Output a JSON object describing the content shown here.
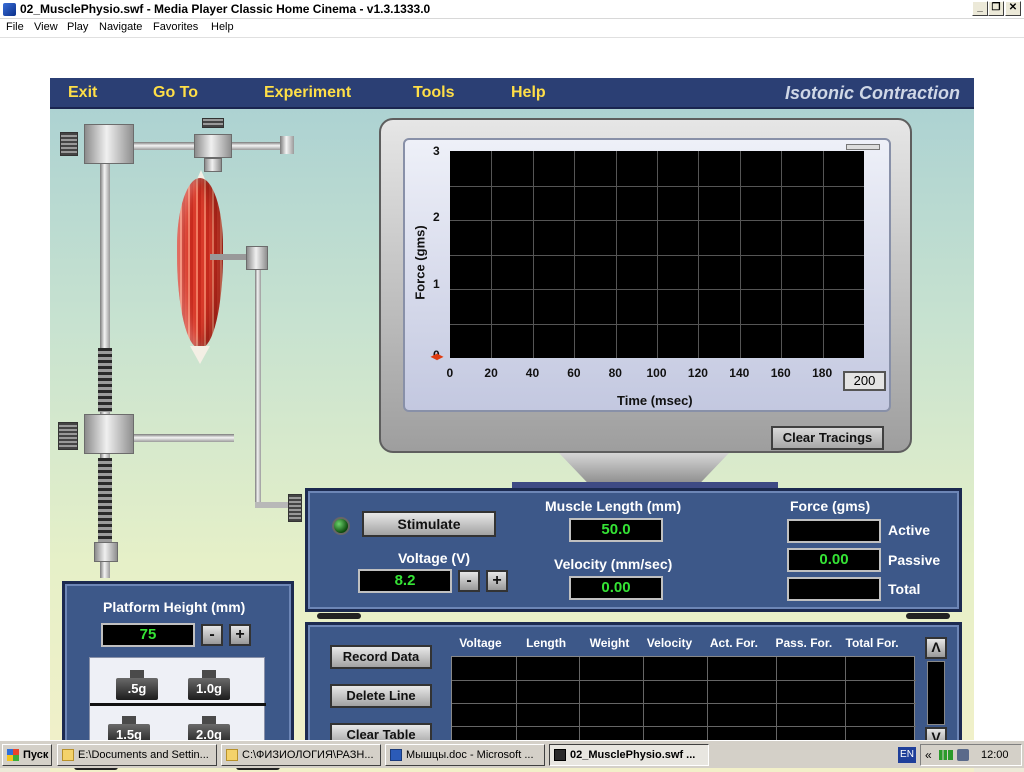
{
  "window": {
    "title": "02_MusclePhysio.swf - Media Player Classic Home Cinema - v1.3.1333.0",
    "buttons": {
      "minimize": "_",
      "restore": "❐",
      "close": "✕"
    }
  },
  "menubar": {
    "items": [
      "File",
      "View",
      "Play",
      "Navigate",
      "Favorites",
      "Help"
    ]
  },
  "nav": {
    "items": [
      "Exit",
      "Go To",
      "Experiment",
      "Tools",
      "Help"
    ],
    "experiment_title": "Isotonic Contraction"
  },
  "oscilloscope": {
    "ylabel": "Force (gms)",
    "xlabel": "Time (msec)",
    "y_ticks": [
      "3",
      "2",
      "1",
      "0"
    ],
    "x_ticks": [
      "0",
      "20",
      "40",
      "60",
      "80",
      "100",
      "120",
      "140",
      "160",
      "180"
    ],
    "x_max_button": "200",
    "clear_label": "Clear Tracings",
    "ylim": [
      0,
      3
    ],
    "xlim": [
      0,
      200
    ]
  },
  "stimulator": {
    "stimulate_label": "Stimulate",
    "voltage_label": "Voltage (V)",
    "voltage_value": "8.2",
    "minus": "-",
    "plus": "+",
    "muscle_length_label": "Muscle Length (mm)",
    "muscle_length_value": "50.0",
    "velocity_label": "Velocity (mm/sec)",
    "velocity_value": "0.00",
    "force_label": "Force (gms)",
    "active_label": "Active",
    "active_value": "",
    "passive_label": "Passive",
    "passive_value": "0.00",
    "total_label": "Total",
    "total_value": ""
  },
  "platform": {
    "label": "Platform Height (mm)",
    "value": "75",
    "minus": "-",
    "plus": "+",
    "weights": [
      ".5g",
      "1.0g",
      "1.5g",
      "2.0g"
    ]
  },
  "data_table": {
    "record_label": "Record Data",
    "delete_label": "Delete Line",
    "clear_label": "Clear Table",
    "columns": [
      "Voltage",
      "Length",
      "Weight",
      "Velocity",
      "Act. For.",
      "Pass. For.",
      "Total For."
    ],
    "scroll_up": "Λ",
    "scroll_down": "V"
  },
  "taskbar": {
    "start_label": "Пуск",
    "tasks": [
      "E:\\Documents and Settin...",
      "C:\\ФИЗИОЛОГИЯ\\РАЗН...",
      "Мышцы.doc - Microsoft ...",
      "02_MusclePhysio.swf ..."
    ],
    "tray_lang": "EN",
    "tray_arrows": "«",
    "clock": "12:00"
  }
}
